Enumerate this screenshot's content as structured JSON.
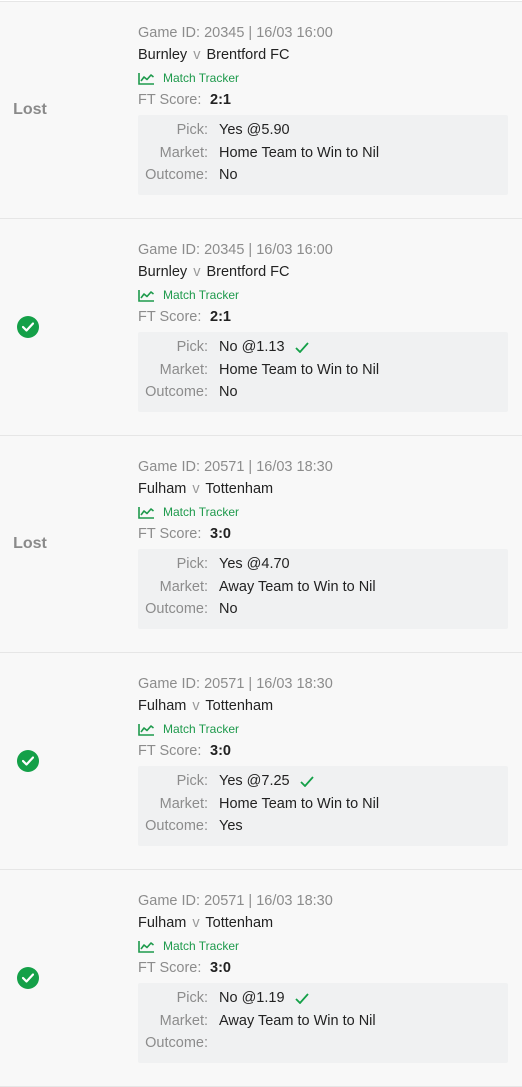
{
  "labels": {
    "ft_score": "FT Score:",
    "pick": "Pick:",
    "market": "Market:",
    "outcome": "Outcome:",
    "match_tracker": "Match Tracker",
    "vs": "v"
  },
  "colors": {
    "win": "#14a048",
    "tracker": "#1e9a4c",
    "muted": "#8c8c8c"
  },
  "bets": [
    {
      "status": "lost",
      "status_label": "Lost",
      "game_id": "Game ID: 20345 | 16/03 16:00",
      "home": "Burnley",
      "away": "Brentford FC",
      "score": "2:1",
      "pick": "Yes @5.90",
      "pick_checked": false,
      "market": "Home Team to Win to Nil",
      "outcome": "No"
    },
    {
      "status": "won",
      "status_label": "",
      "game_id": "Game ID: 20345 | 16/03 16:00",
      "home": "Burnley",
      "away": "Brentford FC",
      "score": "2:1",
      "pick": "No @1.13",
      "pick_checked": true,
      "market": "Home Team to Win to Nil",
      "outcome": "No"
    },
    {
      "status": "lost",
      "status_label": "Lost",
      "game_id": "Game ID: 20571 | 16/03 18:30",
      "home": "Fulham",
      "away": "Tottenham",
      "score": "3:0",
      "pick": "Yes @4.70",
      "pick_checked": false,
      "market": "Away Team to Win to Nil",
      "outcome": "No"
    },
    {
      "status": "won",
      "status_label": "",
      "game_id": "Game ID: 20571 | 16/03 18:30",
      "home": "Fulham",
      "away": "Tottenham",
      "score": "3:0",
      "pick": "Yes @7.25",
      "pick_checked": true,
      "market": "Home Team to Win to Nil",
      "outcome": "Yes"
    },
    {
      "status": "won",
      "status_label": "",
      "game_id": "Game ID: 20571 | 16/03 18:30",
      "home": "Fulham",
      "away": "Tottenham",
      "score": "3:0",
      "pick": "No @1.19",
      "pick_checked": true,
      "market": "Away Team to Win to Nil",
      "outcome": ""
    }
  ]
}
